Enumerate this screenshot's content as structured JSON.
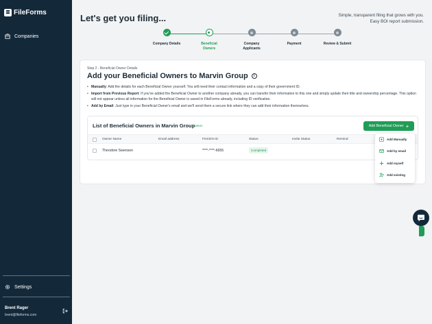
{
  "app": {
    "name": "FileForms"
  },
  "sidebar": {
    "items": [
      {
        "label": "Companies",
        "icon": "building-icon"
      }
    ],
    "settings_label": "Settings",
    "user": {
      "name": "Brent Rager",
      "email": "brent@fileforms.com"
    }
  },
  "header": {
    "title": "Let's get you filing...",
    "tagline_line1": "Simple, transparent filing that grows with you.",
    "tagline_line2": "Easy BOI report submission."
  },
  "stepper": {
    "steps": [
      {
        "line1": "Company Details",
        "line2": "",
        "state": "done"
      },
      {
        "line1": "Beneficial",
        "line2": "Owners",
        "state": "current"
      },
      {
        "line1": "Company",
        "line2": "Applicants",
        "state": "todo"
      },
      {
        "line1": "Payment",
        "line2": "",
        "state": "todo"
      },
      {
        "line1": "Review & Submit",
        "line2": "",
        "state": "todo"
      }
    ]
  },
  "card": {
    "step_caption": "Step 2 - Beneficial Owner Details",
    "title": "Add your Beneficial Owners to Marvin Group",
    "bullets": [
      {
        "lead": "Manually",
        "text": ": Add the details for each Beneficial Owner yourself. You will need their contact information and a copy of their government ID."
      },
      {
        "lead": "Import from Previous Report",
        "text": ": If you've added the Beneficial Owner to another company already, you can transfer their information to this one and simply update their title and ownership percentage. This option will not appear unless all information for the Beneficial Owner is saved in FileForms already, including ID verification."
      },
      {
        "lead": "Add by Email",
        "text": ": Just type in your Beneficial Owner's email and we'll send them a secure link where they can add their information themselves."
      }
    ]
  },
  "owners": {
    "title": "List of Beneficial Owners in Marvin Group",
    "count_label": "1 owner",
    "add_button_label": "Add Beneficial Owner",
    "columns": [
      "Owner Name",
      "Email address",
      "FinCEN ID",
      "Status",
      "Invite Status",
      "Remind"
    ],
    "rows": [
      {
        "name": "Theodore Swenson",
        "email": "",
        "fincen": "****-****-6655",
        "status": "Completed",
        "invite": "",
        "remind": ""
      }
    ]
  },
  "add_menu": {
    "items": [
      {
        "label": "Add Manually",
        "icon": "add-box-icon"
      },
      {
        "label": "Add by email",
        "icon": "email-icon"
      },
      {
        "label": "Add myself",
        "icon": "plus-icon"
      },
      {
        "label": "Add existing",
        "icon": "person-add-icon"
      }
    ]
  },
  "colors": {
    "sidebar": "#13293a",
    "accent": "#1f9d57",
    "background": "#f2f3f4"
  }
}
